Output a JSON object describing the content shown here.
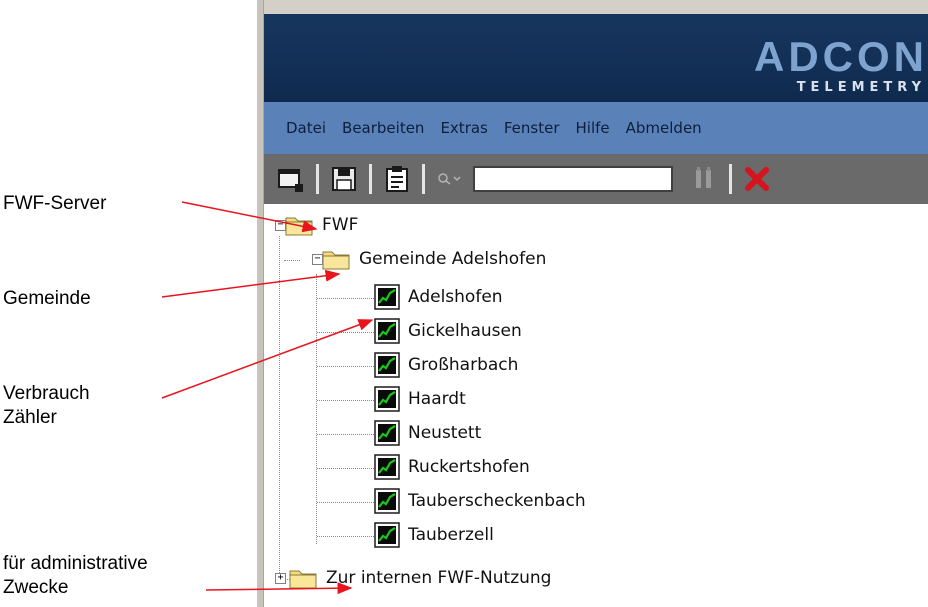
{
  "annotations": {
    "server": "FWF-Server",
    "municipality": "Gemeinde",
    "consumption_line1": "Verbrauch",
    "consumption_line2": "Zähler",
    "admin_line1": "für administrative",
    "admin_line2": "Zwecke"
  },
  "logo": {
    "main": "ADCON",
    "sub": "TELEMETRY"
  },
  "menu": [
    "Datei",
    "Bearbeiten",
    "Extras",
    "Fenster",
    "Hilfe",
    "Abmelden"
  ],
  "toolbar": {
    "search_value": "",
    "icons": [
      "new-window-icon",
      "save-icon",
      "properties-icon",
      "search-icon",
      "connect-icon",
      "close-icon"
    ]
  },
  "tree": {
    "root": "FWF",
    "group": "Gemeinde Adelshofen",
    "stations": [
      "Adelshofen",
      "Gickelhausen",
      "Großharbach",
      "Haardt",
      "Neustett",
      "Ruckertshofen",
      "Tauberscheckenbach",
      "Tauberzell"
    ],
    "internal": "Zur internen FWF-Nutzung"
  },
  "colors": {
    "arrow": "#e8141e",
    "header": "#17365f",
    "menubar": "#5b82b8",
    "toolbar": "#6a6a6a",
    "folder": "#f3dc7c",
    "station_line": "#18c818"
  }
}
